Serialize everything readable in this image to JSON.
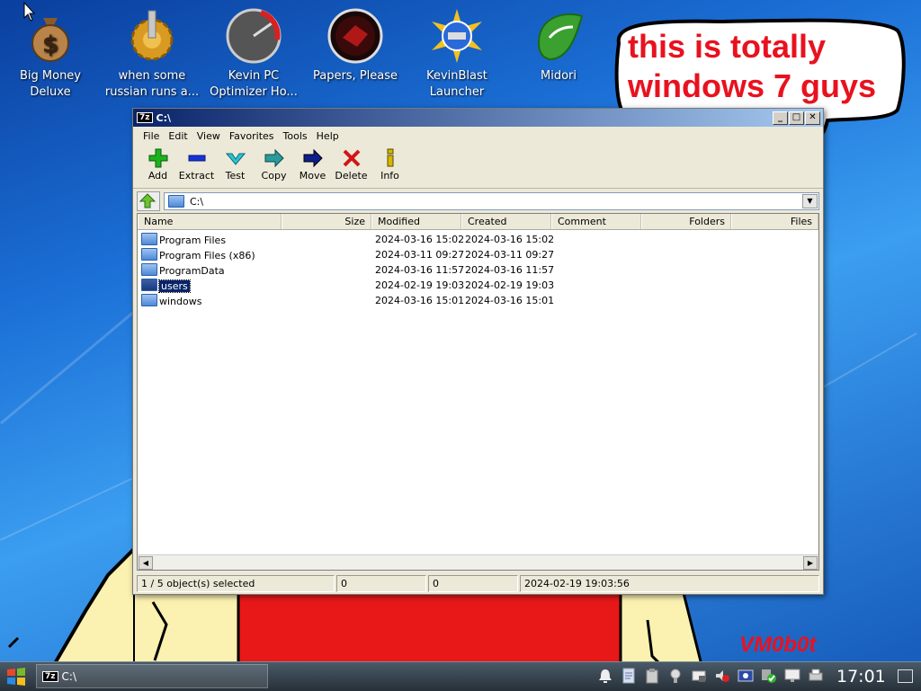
{
  "desktop": {
    "icons": [
      {
        "label_line1": "Big Money",
        "label_line2": "Deluxe",
        "icon": "money-bag-icon"
      },
      {
        "label_line1": "when some",
        "label_line2": "russian runs a...",
        "icon": "gear-icon"
      },
      {
        "label_line1": "Kevin PC",
        "label_line2": "Optimizer Ho...",
        "icon": "gauge-icon"
      },
      {
        "label_line1": "Papers, Please",
        "label_line2": "",
        "icon": "papers-please-icon"
      },
      {
        "label_line1": "KevinBlast",
        "label_line2": "Launcher",
        "icon": "globe-icon"
      },
      {
        "label_line1": "Midori",
        "label_line2": "",
        "icon": "midori-leaf-icon"
      }
    ],
    "bubble": {
      "line1": "this is totally",
      "line2": "windows 7 guys"
    },
    "watermark": "VM0b0t"
  },
  "window": {
    "title": "C:\\",
    "app_badge": "7z",
    "menu": [
      "File",
      "Edit",
      "View",
      "Favorites",
      "Tools",
      "Help"
    ],
    "toolbar": [
      {
        "label": "Add",
        "icon": "plus-icon",
        "color": "#1bb31b"
      },
      {
        "label": "Extract",
        "icon": "minus-icon",
        "color": "#1633d6"
      },
      {
        "label": "Test",
        "icon": "check-icon",
        "color": "#2bb4c4"
      },
      {
        "label": "Copy",
        "icon": "copy-arrow-icon",
        "color": "#2a8a8a"
      },
      {
        "label": "Move",
        "icon": "move-arrow-icon",
        "color": "#0d1f8a"
      },
      {
        "label": "Delete",
        "icon": "delete-x-icon",
        "color": "#d01616"
      },
      {
        "label": "Info",
        "icon": "info-icon",
        "color": "#d4b800"
      }
    ],
    "address": "C:\\",
    "columns": [
      "Name",
      "Size",
      "Modified",
      "Created",
      "Comment",
      "Folders",
      "Files"
    ],
    "rows": [
      {
        "name": "Program Files",
        "size": "",
        "modified": "2024-03-16 15:02",
        "created": "2024-03-16 15:02"
      },
      {
        "name": "Program Files (x86)",
        "size": "",
        "modified": "2024-03-11 09:27",
        "created": "2024-03-11 09:27"
      },
      {
        "name": "ProgramData",
        "size": "",
        "modified": "2024-03-16 11:57",
        "created": "2024-03-16 11:57"
      },
      {
        "name": "users",
        "size": "",
        "modified": "2024-02-19 19:03",
        "created": "2024-02-19 19:03",
        "selected": true
      },
      {
        "name": "windows",
        "size": "",
        "modified": "2024-03-16 15:01",
        "created": "2024-03-16 15:01"
      }
    ],
    "status": {
      "selection": "1 / 5 object(s) selected",
      "size": "0",
      "packed": "0",
      "modified": "2024-02-19 19:03:56"
    }
  },
  "taskbar": {
    "task_label": "C:\\",
    "task_badge": "7z",
    "clock": "17:01",
    "tray_icons": [
      "bell-icon",
      "document-icon",
      "clipboard-icon",
      "bulb-icon",
      "network-lock-icon",
      "volume-muted-icon",
      "display-settings-icon",
      "shield-check-icon",
      "monitor-icon",
      "printer-icon"
    ]
  },
  "colors": {
    "selection": "#0a246a",
    "bubble_text": "#e8121f",
    "title_gradient_start": "#0a246a"
  }
}
